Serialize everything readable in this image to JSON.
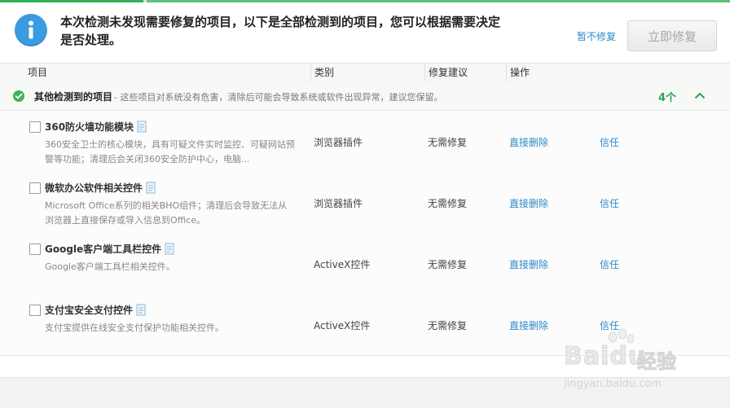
{
  "header": {
    "message": "本次检测未发现需要修复的项目，以下是全部检测到的项目，您可以根据需要决定是否处理。",
    "skip_link": "暂不修复",
    "fix_button": "立即修复"
  },
  "columns": {
    "item": "项目",
    "category": "类别",
    "advice": "修复建议",
    "action": "操作"
  },
  "group": {
    "title": "其他检测到的项目",
    "description": "- 这些项目对系统没有危害，清除后可能会导致系统或软件出现异常，建议您保留。",
    "count": "4个"
  },
  "rows": [
    {
      "name": "360防火墙功能模块",
      "description": "360安全卫士的核心模块，具有可疑文件实时监控、可疑网站预警等功能；清理后会关闭360安全防护中心，电脑...",
      "category": "浏览器插件",
      "advice": "无需修复",
      "delete_label": "直接删除",
      "trust_label": "信任"
    },
    {
      "name": "微软办公软件相关控件",
      "description": "Microsoft Office系列的相关BHO组件；清理后会导致无法从浏览器上直接保存或导入信息到Office。",
      "category": "浏览器插件",
      "advice": "无需修复",
      "delete_label": "直接删除",
      "trust_label": "信任"
    },
    {
      "name": "Google客户端工具栏控件",
      "description": "Google客户端工具栏相关控件。",
      "category": "ActiveX控件",
      "advice": "无需修复",
      "delete_label": "直接删除",
      "trust_label": "信任"
    },
    {
      "name": "支付宝安全支付控件",
      "description": "支付宝提供在线安全支付保护功能相关控件。",
      "category": "ActiveX控件",
      "advice": "无需修复",
      "delete_label": "直接删除",
      "trust_label": "信任"
    }
  ],
  "watermark": {
    "brand": "Bai",
    "brand_tail": "du",
    "brand_cn": "经验",
    "url": "jingyan.baidu.com"
  },
  "colors": {
    "accent_green": "#2fb35b",
    "link_blue": "#2f88c8",
    "info_blue": "#3a9be0"
  },
  "icons": [
    "info-icon",
    "check-circle-icon",
    "chevron-up-icon",
    "document-icon",
    "baidu-paw-icon"
  ]
}
